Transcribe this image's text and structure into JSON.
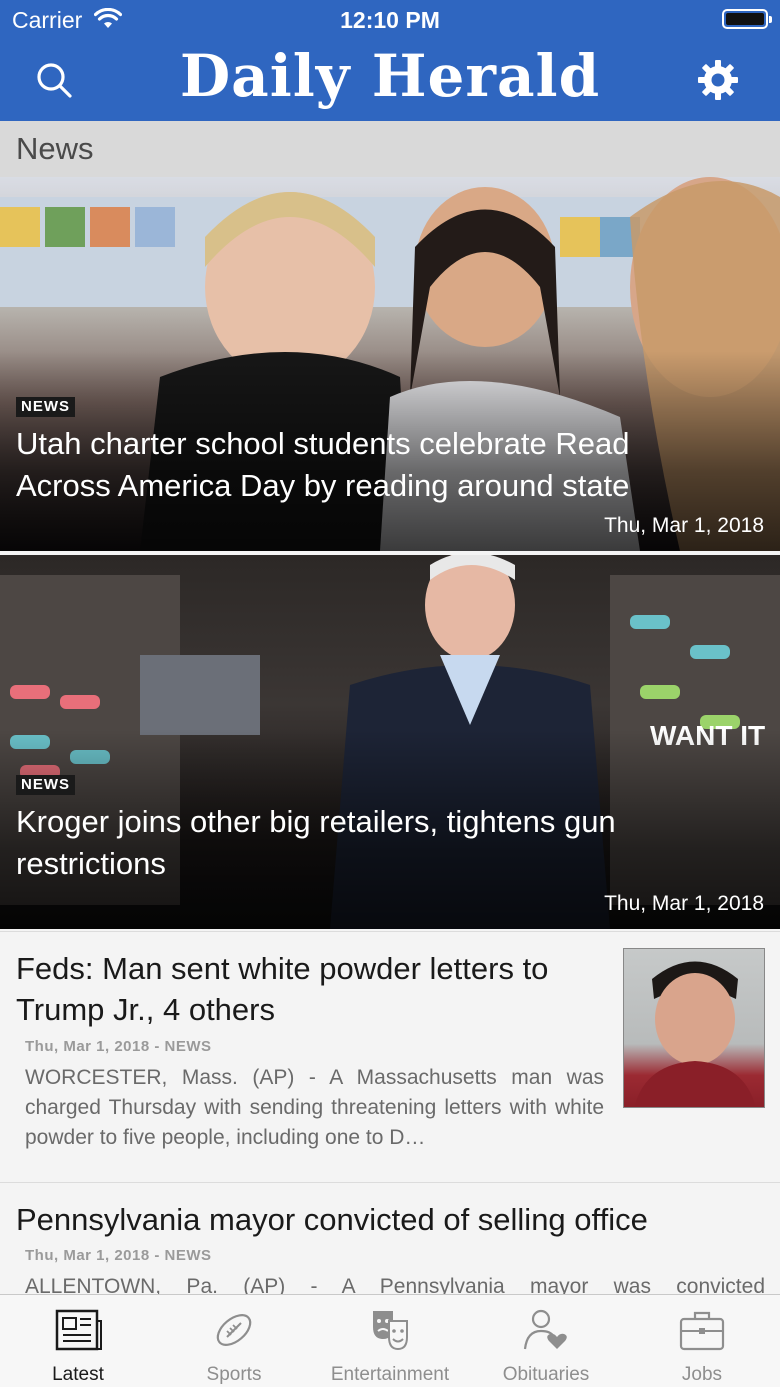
{
  "status_bar": {
    "carrier": "Carrier",
    "time": "12:10 PM",
    "battery_level": 1.0
  },
  "header": {
    "brand": "Daily Herald",
    "search_icon": "search-icon",
    "settings_icon": "gear-icon"
  },
  "section": {
    "title": "News"
  },
  "features": [
    {
      "tag": "NEWS",
      "title": "Utah charter school students celebrate Read Across America Day by reading around state",
      "date": "Thu, Mar 1, 2018"
    },
    {
      "tag": "NEWS",
      "title": "Kroger joins other big retailers, tightens gun restrictions",
      "date": "Thu, Mar 1, 2018"
    }
  ],
  "articles": [
    {
      "title": "Feds: Man sent white powder letters to Trump Jr., 4 others",
      "meta": "Thu, Mar 1, 2018 - NEWS",
      "excerpt": "WORCESTER, Mass. (AP) - A Massachusetts man was charged Thursday with sending threatening letters with white powder to five people, including one to D…"
    },
    {
      "title": "Pennsylvania mayor convicted of selling office",
      "meta": "Thu, Mar 1, 2018 - NEWS",
      "excerpt": "ALLENTOWN, Pa. (AP) - A Pennsylvania mayor was convicted"
    }
  ],
  "tabs": [
    {
      "label": "Latest",
      "icon": "newspaper-icon",
      "active": true
    },
    {
      "label": "Sports",
      "icon": "football-icon",
      "active": false
    },
    {
      "label": "Entertainment",
      "icon": "theater-masks-icon",
      "active": false
    },
    {
      "label": "Obituaries",
      "icon": "person-heart-icon",
      "active": false
    },
    {
      "label": "Jobs",
      "icon": "briefcase-icon",
      "active": false
    }
  ],
  "colors": {
    "header": "#2f66c0",
    "section_bar": "#d9d9d9",
    "tab_active": "#1a1a1a",
    "tab_inactive": "#8e8e8e"
  }
}
